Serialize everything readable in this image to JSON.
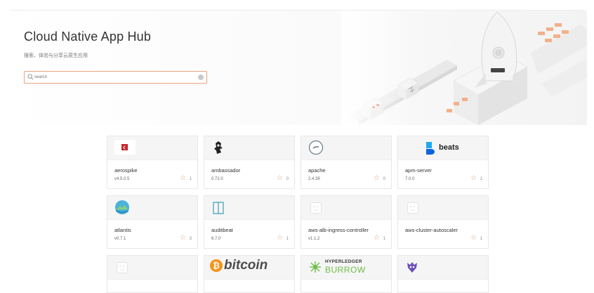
{
  "header": {
    "title": "Cloud Native App Hub",
    "subtitle": "搜索、体验与分享云原生应用",
    "search_placeholder": "search"
  },
  "apps": [
    {
      "name": "aerospike",
      "version": "v4.5.0.5",
      "stars": "1",
      "logo": "aerospike-logo"
    },
    {
      "name": "ambassador",
      "version": "0.72.0",
      "stars": "0",
      "logo": "ambassador-logo"
    },
    {
      "name": "apache",
      "version": "2.4.39",
      "stars": "0",
      "logo": "apache-logo"
    },
    {
      "name": "apm-server",
      "version": "7.0.0",
      "stars": "1",
      "logo": "beats-logo",
      "logo_text": "beats"
    },
    {
      "name": "atlantis",
      "version": "v0.7.1",
      "stars": "3",
      "logo": "atlantis-logo"
    },
    {
      "name": "auditbeat",
      "version": "6.7.0",
      "stars": "1",
      "logo": "auditbeat-logo"
    },
    {
      "name": "aws-alb-ingress-controller",
      "version": "v1.1.2",
      "stars": "1",
      "logo": "placeholder-logo"
    },
    {
      "name": "aws-cluster-autoscaler",
      "version": "",
      "stars": "1",
      "logo": "placeholder-logo"
    }
  ],
  "partial_row": [
    {
      "logo": "placeholder-logo"
    },
    {
      "logo": "bitcoin-logo",
      "logo_text": "bitcoin"
    },
    {
      "logo": "hyperledger-burrow-logo",
      "logo_text_top": "HYPERLEDGER",
      "logo_text_bottom": "BURROW"
    },
    {
      "logo": "purple-mascot-logo"
    }
  ],
  "colors": {
    "accent": "#e6a57e",
    "aerospike_red": "#c8232c",
    "bitcoin_orange": "#f7931a",
    "burrow_green": "#6ebd46",
    "beats_blue": "#0077cc",
    "purple": "#6b4fbb"
  }
}
